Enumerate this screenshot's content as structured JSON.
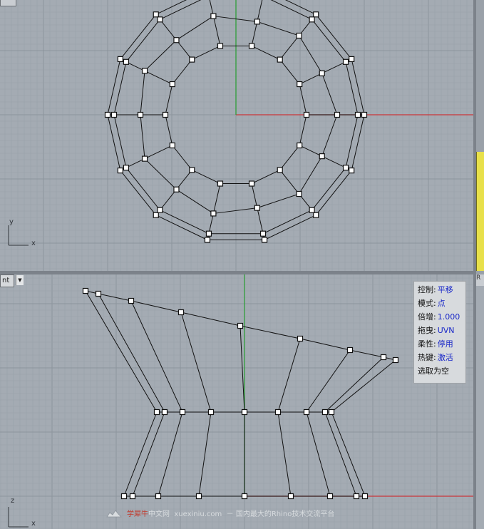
{
  "viewports": {
    "top": {
      "axis_y": "y",
      "axis_x": "x"
    },
    "front": {
      "tab_label": "nt",
      "tab_arrow": "▼",
      "axis_z": "z",
      "axis_x": "x",
      "right_tab_label": "R"
    }
  },
  "colors": {
    "viewport_bg": "#a4abb3",
    "grid_minor": "#98a0a8",
    "grid_major": "#8c949c",
    "axis_x": "#c9353a",
    "axis_y": "#2f9e3a",
    "wire": "#111111",
    "point_fill": "#ffffff",
    "object_yellow": "#e8e04a"
  },
  "panel": {
    "rows": [
      {
        "key": "控制:",
        "value": "平移"
      },
      {
        "key": "模式:",
        "value": "点"
      },
      {
        "key": "倍增:",
        "value": "1.000"
      },
      {
        "key": "拖曳:",
        "value": "UVN"
      },
      {
        "key": "柔性:",
        "value": "停用"
      },
      {
        "key": "热键:",
        "value": "激活"
      },
      {
        "key": "选取为空",
        "value": ""
      }
    ]
  },
  "watermark": {
    "brand_part1": "学犀牛",
    "brand_part2": "中文网",
    "url": "xuexiniu.com",
    "separator": "－",
    "tagline": "国内最大的Rhino技术交流平台",
    "logo_icon": "rhino-logo-icon"
  }
}
